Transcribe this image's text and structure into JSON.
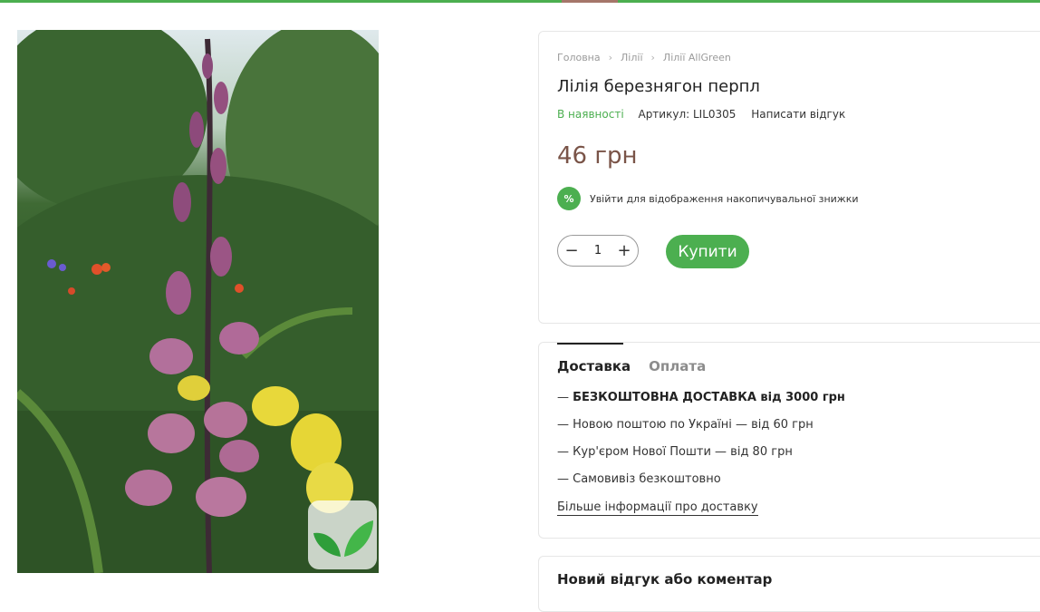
{
  "breadcrumb": {
    "home": "Головна",
    "category": "Лілії",
    "subcategory": "Лілії AllGreen"
  },
  "product": {
    "title": "Лілія березнягон перпл",
    "stock": "В наявності",
    "sku": "Артикул: LIL0305",
    "write_review": "Написати відгук",
    "price": "46 грн",
    "discount_badge": "%",
    "discount_text": "Увійти для відображення накопичувальної знижки",
    "quantity": "1",
    "buy_label": "Купити",
    "image_icon": "leaf-logo-icon"
  },
  "delivery": {
    "tabs": [
      "Доставка",
      "Оплата"
    ],
    "items": [
      {
        "prefix": "— ",
        "text": "БЕЗКОШТОВНА ДОСТАВКА від 3000 грн"
      },
      {
        "prefix": "— ",
        "text": "Новою поштою по Україні — від 60 грн"
      },
      {
        "prefix": "— ",
        "text": "Кур'єром Нової Пошти — від 80 грн"
      },
      {
        "prefix": "— ",
        "text": "Самовивіз безкоштовно"
      }
    ],
    "more_link": "Більше інформації про доставку"
  },
  "review": {
    "title": "Новий відгук або коментар"
  },
  "colors": {
    "accent": "#4caf50",
    "price": "#7a5448",
    "top_accent": "#a5766a"
  }
}
